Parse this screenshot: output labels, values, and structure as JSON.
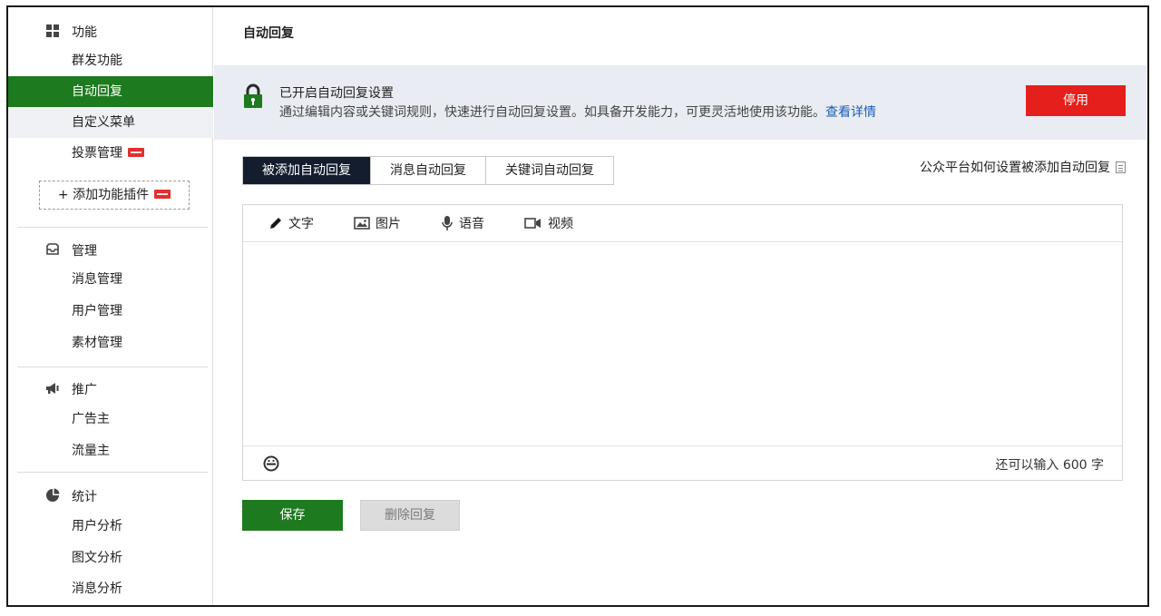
{
  "sidebar": {
    "groups": [
      {
        "title": "功能",
        "icon": "grid-icon",
        "items": [
          {
            "label": "群发功能"
          },
          {
            "label": "自动回复"
          },
          {
            "label": "自定义菜单"
          },
          {
            "label": "投票管理"
          }
        ],
        "add_plugin": "+ 添加功能插件"
      },
      {
        "title": "管理",
        "icon": "inbox-icon",
        "items": [
          {
            "label": "消息管理"
          },
          {
            "label": "用户管理"
          },
          {
            "label": "素材管理"
          }
        ]
      },
      {
        "title": "推广",
        "icon": "megaphone-icon",
        "items": [
          {
            "label": "广告主"
          },
          {
            "label": "流量主"
          }
        ]
      },
      {
        "title": "统计",
        "icon": "pie-chart-icon",
        "items": [
          {
            "label": "用户分析"
          },
          {
            "label": "图文分析"
          },
          {
            "label": "消息分析"
          }
        ]
      }
    ],
    "active_item": "自动回复"
  },
  "main": {
    "page_title": "自动回复",
    "banner": {
      "title": "已开启自动回复设置",
      "description": "通过编辑内容或关键词规则，快速进行自动回复设置。如具备开发能力，可更灵活地使用该功能。",
      "link": "查看详情",
      "button": "停用"
    },
    "tabs": [
      {
        "label": "被添加自动回复"
      },
      {
        "label": "消息自动回复"
      },
      {
        "label": "关键词自动回复"
      }
    ],
    "help_link": "公众平台如何设置被添加自动回复",
    "editor": {
      "tools": [
        {
          "label": "文字",
          "icon": "pencil-icon"
        },
        {
          "label": "图片",
          "icon": "image-icon"
        },
        {
          "label": "语音",
          "icon": "microphone-icon"
        },
        {
          "label": "视频",
          "icon": "video-icon"
        }
      ],
      "counter": "还可以输入 600 字"
    },
    "save_button": "保存",
    "delete_button": "删除回复"
  },
  "colors": {
    "accent_green": "#1e7a1e",
    "danger_red": "#e5201c",
    "tab_active": "#131d2e",
    "banner_bg": "#e9ecf2",
    "link_blue": "#1b5db5"
  }
}
